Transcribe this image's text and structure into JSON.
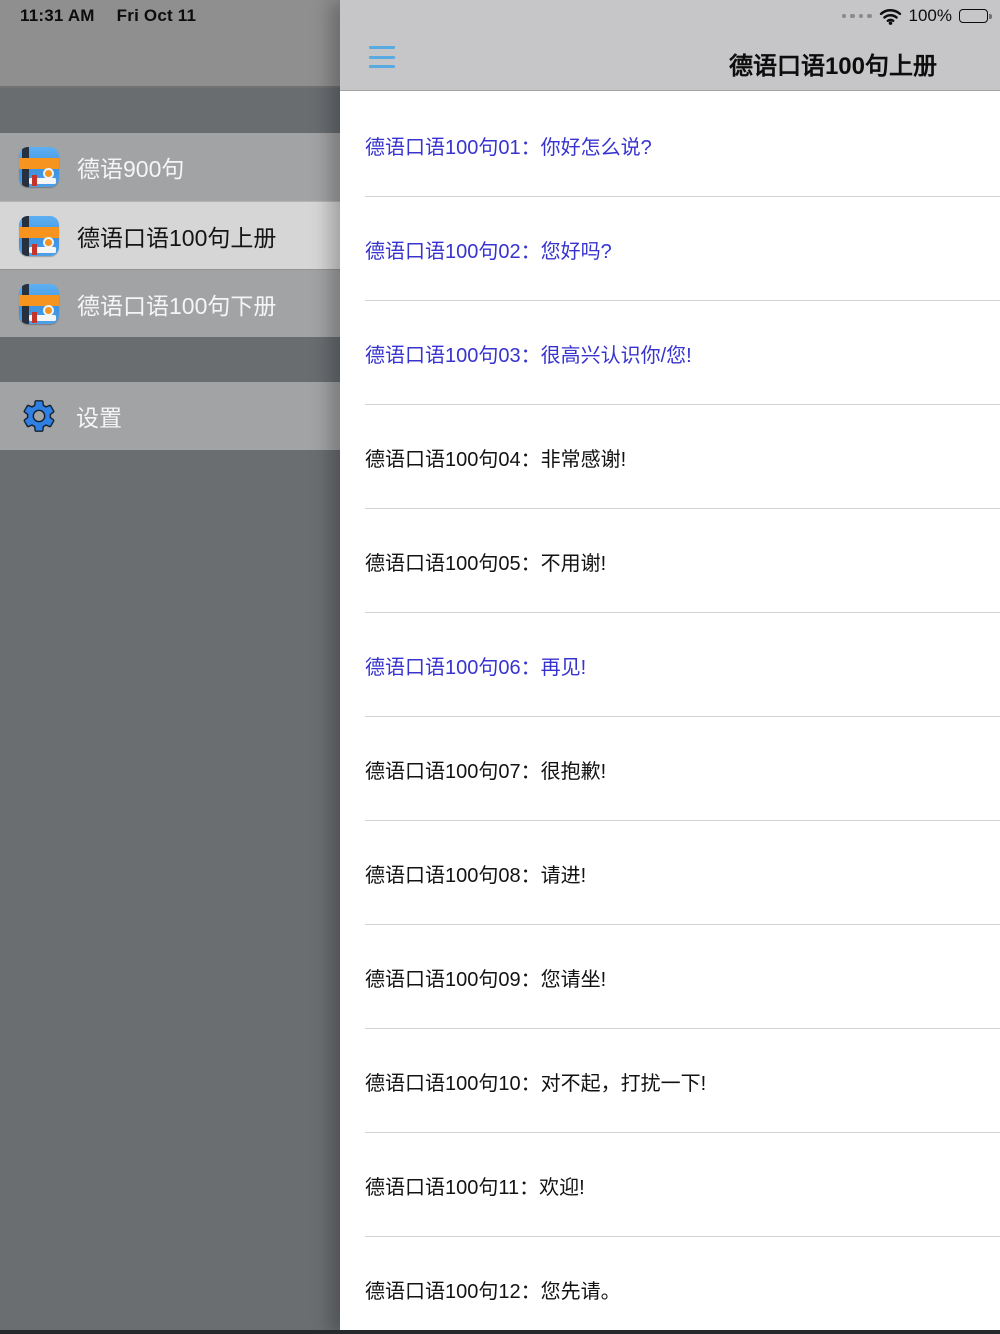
{
  "status_bar": {
    "time": "11:31 AM",
    "date": "Fri Oct 11",
    "battery_percent": "100%"
  },
  "sidebar": {
    "items": [
      {
        "label": "德语900句",
        "selected": false
      },
      {
        "label": "德语口语100句上册",
        "selected": true
      },
      {
        "label": "德语口语100句下册",
        "selected": false
      }
    ],
    "settings_label": "设置"
  },
  "header": {
    "title": "德语口语100句上册"
  },
  "list": {
    "items": [
      {
        "label": "德语口语100句01：你好怎么说?",
        "visited": true
      },
      {
        "label": "德语口语100句02：您好吗?",
        "visited": true
      },
      {
        "label": "德语口语100句03：很高兴认识你/您!",
        "visited": true
      },
      {
        "label": "德语口语100句04：非常感谢!",
        "visited": false
      },
      {
        "label": "德语口语100句05：不用谢!",
        "visited": false
      },
      {
        "label": "德语口语100句06：再见!",
        "visited": true
      },
      {
        "label": "德语口语100句07：很抱歉!",
        "visited": false
      },
      {
        "label": "德语口语100句08：请进!",
        "visited": false
      },
      {
        "label": "德语口语100句09：您请坐!",
        "visited": false
      },
      {
        "label": "德语口语100句10：对不起，打扰一下!",
        "visited": false
      },
      {
        "label": "德语口语100句11：欢迎!",
        "visited": false
      },
      {
        "label": "德语口语100句12：您先请。",
        "visited": false
      }
    ]
  },
  "colors": {
    "link_blue": "#3733d0",
    "accent_blue": "#57abe0",
    "navbar_gray": "#c6c6c8",
    "sidebar_dark": "#6a6e71"
  }
}
